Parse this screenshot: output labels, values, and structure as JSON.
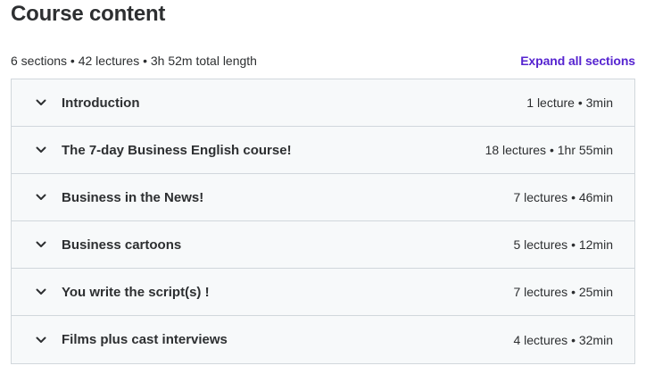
{
  "header": {
    "title": "Course content",
    "summary": "6 sections • 42 lectures • 3h 52m total length",
    "expand_all_label": "Expand all sections"
  },
  "sections": [
    {
      "title": "Introduction",
      "meta": "1 lecture • 3min",
      "icon": "chevron-down-icon"
    },
    {
      "title": "The 7-day Business English course!",
      "meta": "18 lectures • 1hr 55min",
      "icon": "chevron-down-icon"
    },
    {
      "title": "Business in the News!",
      "meta": "7 lectures • 46min",
      "icon": "chevron-down-icon"
    },
    {
      "title": "Business cartoons",
      "meta": "5 lectures • 12min",
      "icon": "chevron-down-icon"
    },
    {
      "title": "You write the script(s) !",
      "meta": "7 lectures • 25min",
      "icon": "chevron-down-icon"
    },
    {
      "title": "Films plus cast interviews",
      "meta": "4 lectures • 32min",
      "icon": "chevron-down-icon"
    }
  ],
  "colors": {
    "text": "#2d2f31",
    "accent": "#5624d0",
    "section_bg": "#f7f9fa",
    "border": "#d1d7dc"
  }
}
